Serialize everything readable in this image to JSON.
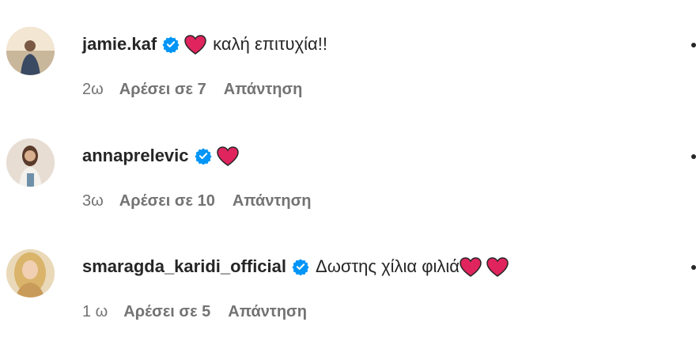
{
  "comments": [
    {
      "username": "jamie.kaf",
      "verified": true,
      "text": "καλή επιτυχία!!",
      "emoji": "red-heart",
      "time": "2ω",
      "likes": "Αρέσει σε 7",
      "reply": "Απάντηση"
    },
    {
      "username": "annaprelevic",
      "verified": true,
      "text": "",
      "emoji": "red-heart",
      "time": "3ω",
      "likes": "Αρέσει σε 10",
      "reply": "Απάντηση"
    },
    {
      "username": "smaragda_karidi_official",
      "verified": true,
      "text": "Δωστης χίλια φιλιά",
      "emoji": "red-heart",
      "time": "1 ω",
      "likes": "Αρέσει σε 5",
      "reply": "Απάντηση"
    }
  ],
  "colors": {
    "text": "#262626",
    "meta": "#737373",
    "verified": "#0095f6",
    "heart": "#e0245e"
  }
}
